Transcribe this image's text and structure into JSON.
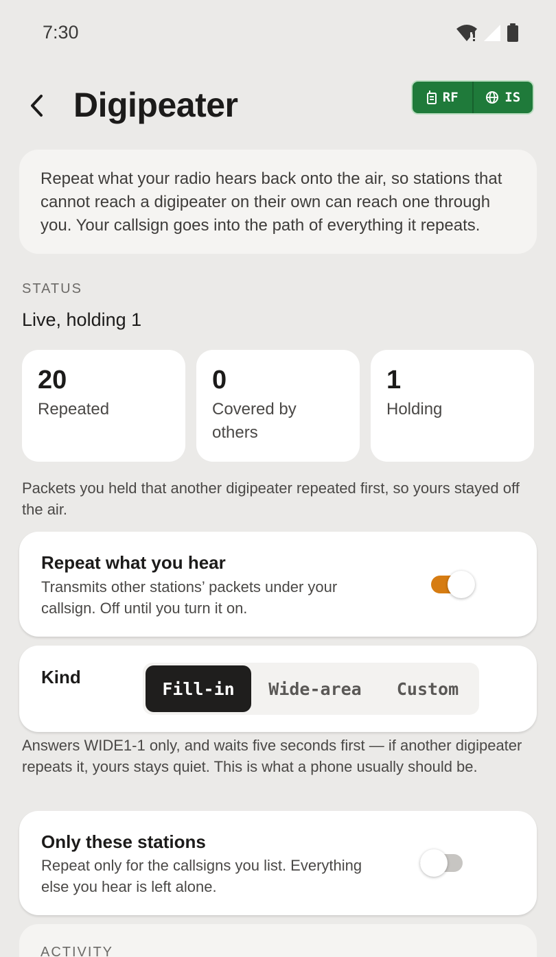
{
  "status_bar": {
    "time": "7:30"
  },
  "header": {
    "back_icon": "chevron-left-icon",
    "title": "Digipeater",
    "modes": [
      {
        "label": "RF",
        "icon": "radio-icon"
      },
      {
        "label": "IS",
        "icon": "globe-icon"
      }
    ]
  },
  "intro": {
    "text": "Repeat what your radio hears back onto the air, so stations that cannot reach a digipeater on their own can reach one through you. Your callsign goes into the path of everything it repeats."
  },
  "status": {
    "label": "STATUS",
    "value": "Live, holding 1",
    "stats": [
      {
        "value": "20",
        "label": "Repeated"
      },
      {
        "value": "0",
        "label": "Covered by others"
      },
      {
        "value": "1",
        "label": "Holding"
      }
    ],
    "note": "Packets you held that another digipeater repeated first, so yours stayed off the air."
  },
  "repeat": {
    "title": "Repeat what you hear",
    "subtitle": "Transmits other stations’ packets under your callsign. Off until you turn it on.",
    "enabled": true
  },
  "kind": {
    "title": "Kind",
    "options": [
      "Fill-in",
      "Wide-area",
      "Custom"
    ],
    "selected": "Fill-in",
    "description": "Answers WIDE1-1 only, and waits five seconds first — if another digipeater repeats it, yours stays quiet. This is what a phone usually should be."
  },
  "only_these": {
    "title": "Only these stations",
    "subtitle": "Repeat only for the callsigns you list. Everything else you hear is left alone.",
    "enabled": false
  },
  "activity": {
    "label": "ACTIVITY"
  },
  "colors": {
    "accent": "#d67c12",
    "mode_green": "#1f7a3a",
    "background": "#ebeae8",
    "card": "#ffffff"
  }
}
